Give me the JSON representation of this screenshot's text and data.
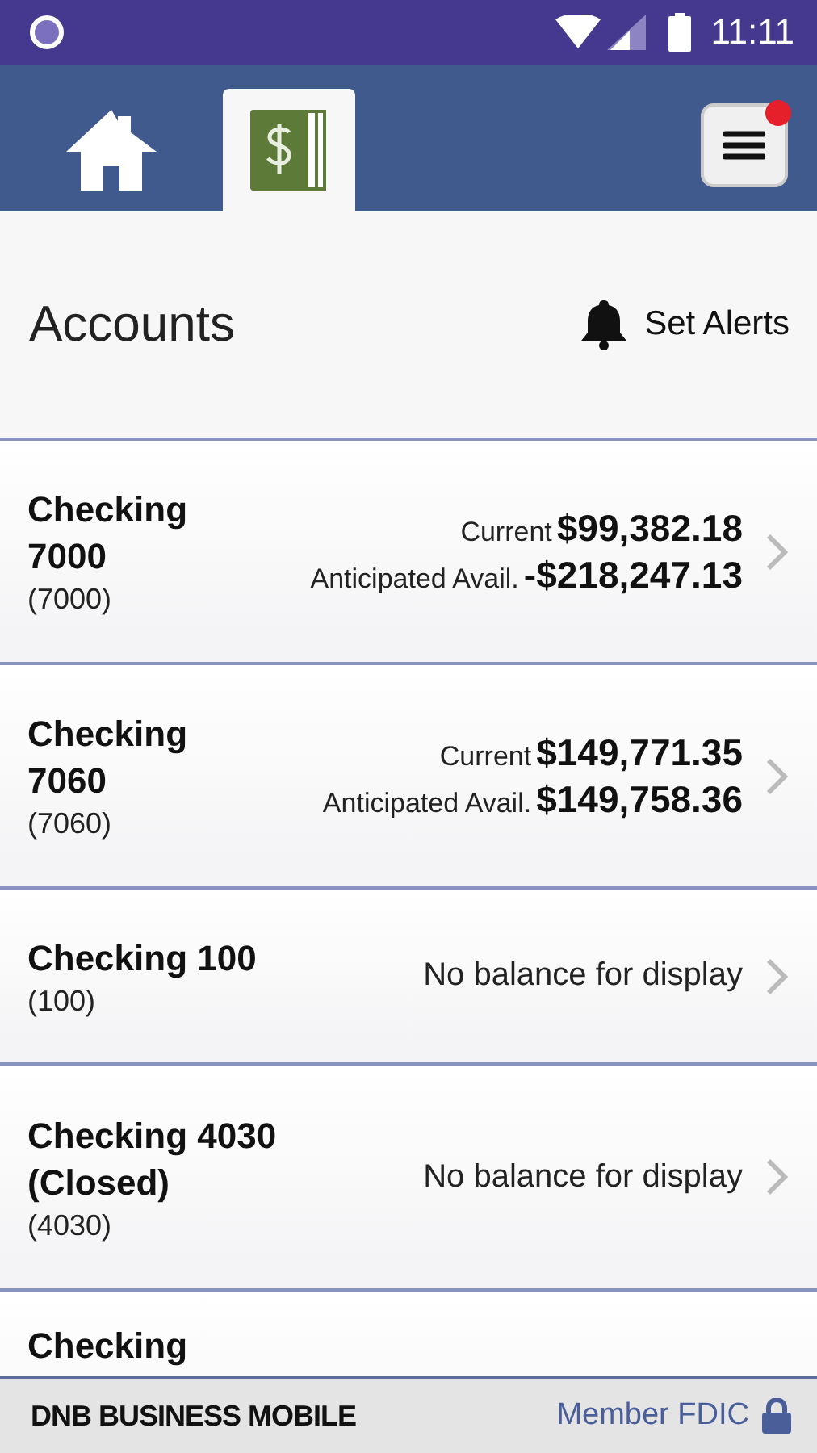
{
  "status_bar": {
    "time": "11:11"
  },
  "nav": {
    "tabs": [
      {
        "kind": "home",
        "selected": false
      },
      {
        "kind": "accounts",
        "selected": true
      }
    ],
    "menu": {
      "notification": true
    }
  },
  "page": {
    "title": "Accounts",
    "alerts_button": "Set Alerts"
  },
  "accounts": [
    {
      "kind": "balance",
      "name": "Checking 7000",
      "number": "(7000)",
      "current_label": "Current",
      "current": "$99,382.18",
      "avail_label": "Anticipated Avail.",
      "avail": "-$218,247.13"
    },
    {
      "kind": "balance",
      "name": "Checking 7060",
      "number": "(7060)",
      "current_label": "Current",
      "current": "$149,771.35",
      "avail_label": "Anticipated Avail.",
      "avail": "$149,758.36"
    },
    {
      "kind": "none",
      "name": "Checking 100",
      "number": "(100)",
      "message": "No balance for display"
    },
    {
      "kind": "none",
      "name": "Checking 4030 (Closed)",
      "number": "(4030)",
      "message": "No balance for display"
    },
    {
      "kind": "partial",
      "name": "Checking"
    }
  ],
  "footer": {
    "brand": "DNB BUSINESS MOBILE",
    "member": "Member FDIC"
  }
}
